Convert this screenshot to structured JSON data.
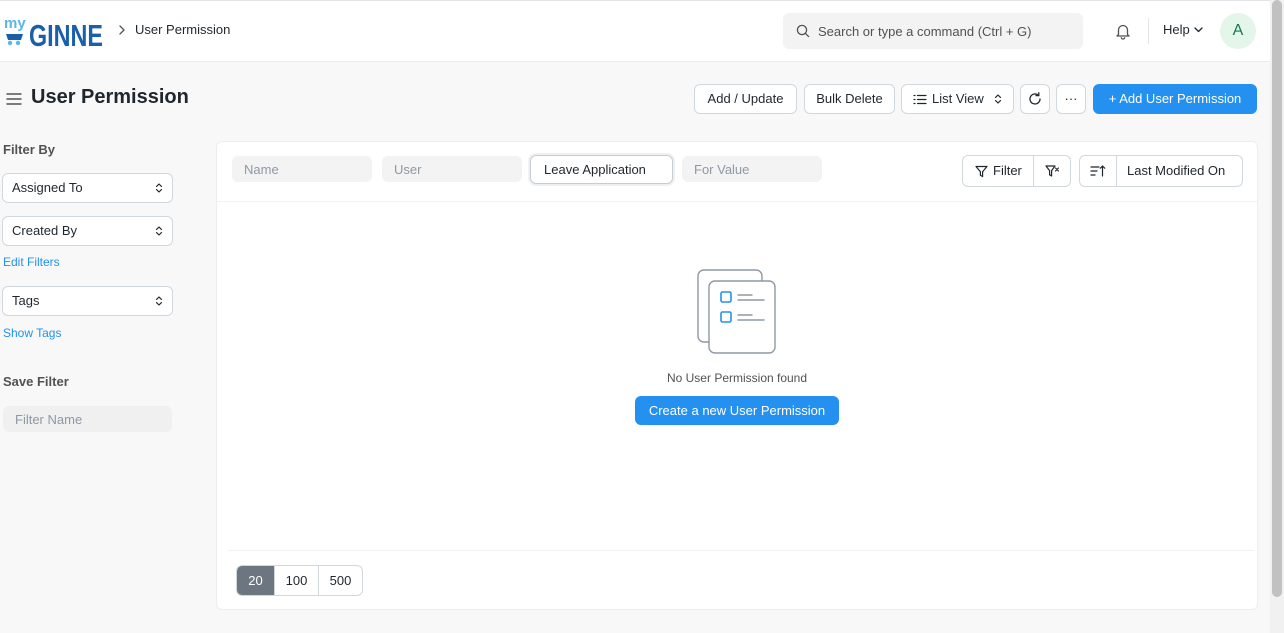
{
  "navbar": {
    "logo_text_my": "my",
    "logo_text_brand": "GINNE",
    "breadcrumb": "User Permission",
    "search_placeholder": "Search or type a command (Ctrl + G)",
    "help_label": "Help",
    "avatar_initial": "A"
  },
  "page": {
    "title": "User Permission",
    "actions": {
      "add_update": "Add / Update",
      "bulk_delete": "Bulk Delete",
      "list_view": "List View",
      "more": "···",
      "add_new": "+ Add User Permission"
    }
  },
  "sidebar": {
    "filter_by_label": "Filter By",
    "assigned_to": "Assigned To",
    "created_by": "Created By",
    "edit_filters": "Edit Filters",
    "tags": "Tags",
    "show_tags": "Show Tags",
    "save_filter_label": "Save Filter",
    "filter_name_placeholder": "Filter Name"
  },
  "list": {
    "filters": {
      "name_placeholder": "Name",
      "user_placeholder": "User",
      "allow_value": "Leave Application",
      "for_value_placeholder": "For Value"
    },
    "filter_button": "Filter",
    "sort_label": "Last Modified On",
    "empty_message": "No User Permission found",
    "create_button": "Create a new User Permission",
    "page_sizes": [
      "20",
      "100",
      "500"
    ],
    "selected_page_size": "20"
  },
  "colors": {
    "primary": "#2490ef",
    "logo_blue": "#1a5fa8",
    "logo_light": "#5bb5e8"
  }
}
